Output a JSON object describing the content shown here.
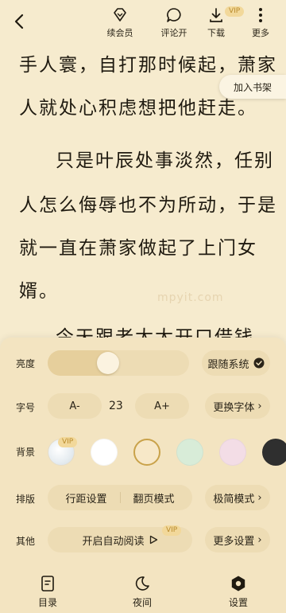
{
  "toolbar": {
    "renew_vip": "续会员",
    "comments": "评论开",
    "download": "下载",
    "download_badge": "VIP",
    "more": "更多"
  },
  "reader": {
    "lines": [
      "手人寰，自打那时候起，萧家",
      "人就处心积虑想把他赶走。",
      "只是叶辰处事淡然，任别",
      "人怎么侮辱也不为所动，于是",
      "就一直在萧家做起了上门女",
      "婿。",
      "今天跟老太太开口借钱"
    ],
    "add_to_shelf": "加入书架",
    "watermark": "mpyit.com"
  },
  "settings": {
    "brightness": {
      "label": "亮度",
      "level_percent": 30,
      "follow_system": "跟随系统"
    },
    "font_size": {
      "label": "字号",
      "decrease": "A-",
      "value": "23",
      "increase": "A+",
      "change_font": "更换字体"
    },
    "background": {
      "label": "背景",
      "vip_badge": "VIP",
      "swatches": [
        "#ffffff",
        "#f7e8c8",
        "#d8ecd8",
        "#f3dde6",
        "#2f2f2f"
      ],
      "selected_index": 1
    },
    "layout": {
      "label": "排版",
      "line_spacing": "行距设置",
      "page_turn": "翻页模式",
      "minimal": "极简模式"
    },
    "other": {
      "label": "其他",
      "auto_read": "开启自动阅读",
      "auto_read_badge": "VIP",
      "more_settings": "更多设置"
    }
  },
  "bottom_nav": {
    "catalog": "目录",
    "night": "夜间",
    "settings": "设置"
  },
  "colors": {
    "page_bg": "#f6ebce",
    "panel_bg": "#f3e4c1",
    "pill_bg": "#eddcb4",
    "vip_gold": "#b98b2d",
    "selected_ring": "#c9a24a"
  }
}
